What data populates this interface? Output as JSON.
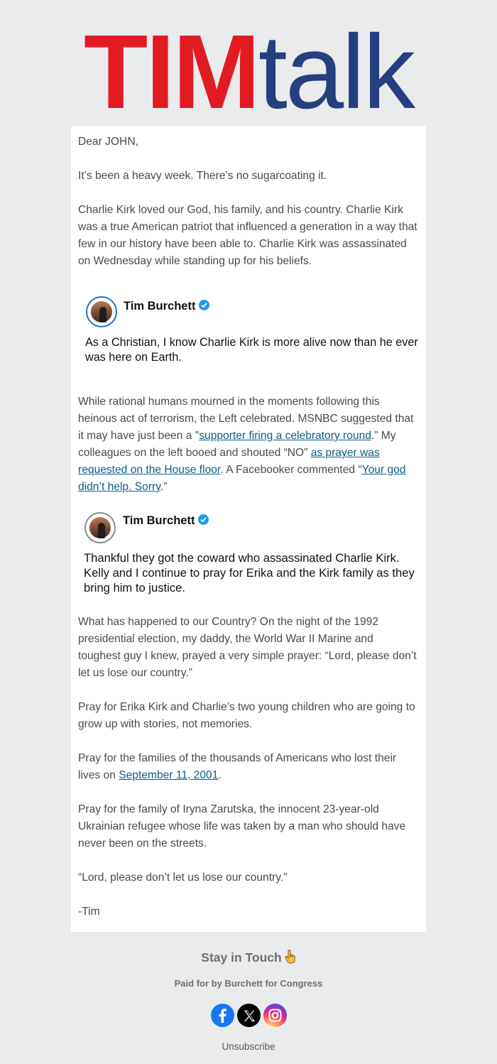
{
  "logo": {
    "part1": "TIM",
    "part2": "talk"
  },
  "email": {
    "greeting": "Dear JOHN,",
    "p1": "It’s been a heavy week. There’s no sugarcoating it.",
    "p2": "Charlie Kirk loved our God, his family, and his country. Charlie Kirk was a true American patriot that influenced a generation in a way that few in our history have been able to. Charlie Kirk was assassinated on Wednesday while standing up for his beliefs.",
    "tweet1": {
      "name": "Tim Burchett",
      "text": "As a Christian, I know Charlie Kirk is more alive now than he ever was here on Earth."
    },
    "p3": {
      "t1": "While rational humans mourned in the moments following this heinous act of terrorism, the Left celebrated. MSNBC suggested that it may have just been a \"",
      "link1": "supporter firing a celebratory round",
      "t2": ".” My colleagues on the left booed and shouted “NO” ",
      "link2": "as prayer was requested on the House floor",
      "t3": ". A Facebooker commented “",
      "link3": "Your god didn’t help. Sorry",
      "t4": ".”"
    },
    "tweet2": {
      "name": "Tim Burchett",
      "text": "Thankful they got the coward who assassinated Charlie Kirk. Kelly and I continue to pray for Erika and the Kirk family as they bring him to justice."
    },
    "p4": "What has happened to our Country? On the night of the 1992 presidential election, my daddy, the World War II Marine and toughest guy I knew, prayed a very simple prayer: “Lord, please don’t let us lose our country.”",
    "p5": "Pray for Erika Kirk and Charlie’s two young children who are going to grow up with stories, not memories.",
    "p6": {
      "t1": "Pray for the families of the thousands of Americans who lost their lives on ",
      "link": "September 11, 2001",
      "t2": "."
    },
    "p7": "Pray for the family of Iryna Zarutska, the innocent 23-year-old Ukrainian refugee whose life was taken by a man who should have never been on the streets.",
    "p8": "“Lord, please don’t let us lose our country.”",
    "signoff": "-Tim"
  },
  "footer": {
    "stay_in_touch": "Stay in Touch",
    "stay_icon": "pointing-down-hand-icon",
    "paid_for": "Paid for by Burchett for Congress",
    "socials": [
      {
        "name": "Facebook",
        "icon": "facebook-icon",
        "color": "#1877f2"
      },
      {
        "name": "X",
        "icon": "x-icon",
        "color": "#000000"
      },
      {
        "name": "Instagram",
        "icon": "instagram-icon",
        "color": "#d6249f"
      }
    ],
    "unsubscribe": "Unsubscribe"
  },
  "colors": {
    "logo_red": "#e21b23",
    "logo_blue": "#263f7e",
    "link": "#0b5d86",
    "verified": "#1d9bf0"
  }
}
